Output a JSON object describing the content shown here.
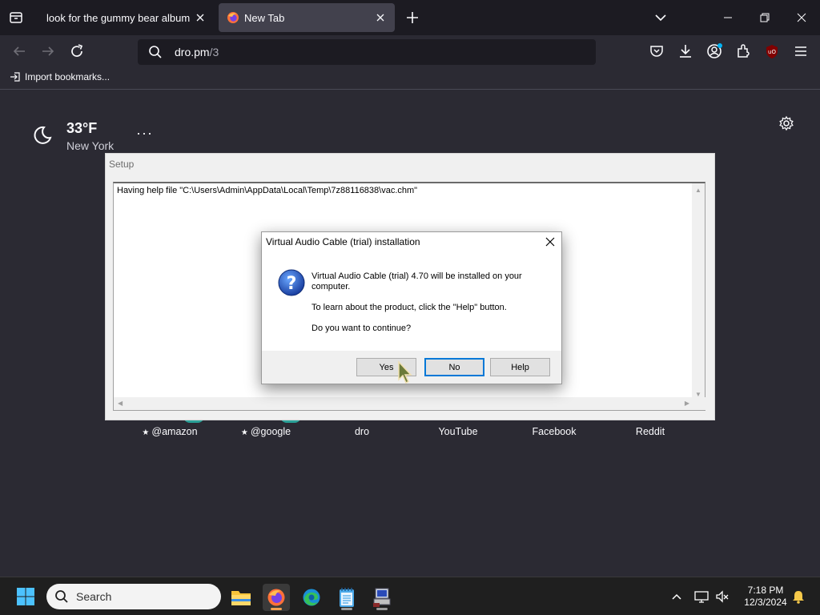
{
  "browser": {
    "tabs": [
      {
        "title": "look for the gummy bear album in",
        "active": false
      },
      {
        "title": "New Tab",
        "active": true,
        "favicon": "firefox-icon"
      }
    ],
    "url": {
      "host": "dro.pm",
      "path": "/3"
    },
    "bookmarks": {
      "import_label": "Import bookmarks..."
    }
  },
  "newtab": {
    "weather": {
      "temp": "33°F",
      "city": "New York",
      "menu": "···"
    },
    "shortcuts": [
      {
        "label": "@amazon",
        "pinned": true
      },
      {
        "label": "@google",
        "pinned": true
      },
      {
        "label": "dro",
        "pinned": false
      },
      {
        "label": "YouTube",
        "pinned": false
      },
      {
        "label": "Facebook",
        "pinned": false
      },
      {
        "label": "Reddit",
        "pinned": false
      }
    ]
  },
  "setup_window": {
    "title": "Setup",
    "log_line": "Having help file \"C:\\Users\\Admin\\AppData\\Local\\Temp\\7z88116838\\vac.chm\""
  },
  "dialog": {
    "title": "Virtual Audio Cable (trial) installation",
    "message_1": "Virtual Audio Cable (trial) 4.70 will be installed on your computer.",
    "message_2": "To learn about the product, click the \"Help\" button.",
    "message_3": "Do you want to continue?",
    "buttons": {
      "yes": "Yes",
      "no": "No",
      "help": "Help"
    }
  },
  "taskbar": {
    "search_label": "Search",
    "time": "7:18 PM",
    "date": "12/3/2024",
    "apps": [
      "file-explorer-icon",
      "firefox-icon",
      "edge-icon",
      "notepad-icon",
      "setup-app-icon"
    ]
  },
  "colors": {
    "browser_bg": "#2b2a33",
    "tab_strip": "#1c1b22",
    "taskbar": "#1f1f1f",
    "dialog_bg": "#f0f0f0"
  }
}
